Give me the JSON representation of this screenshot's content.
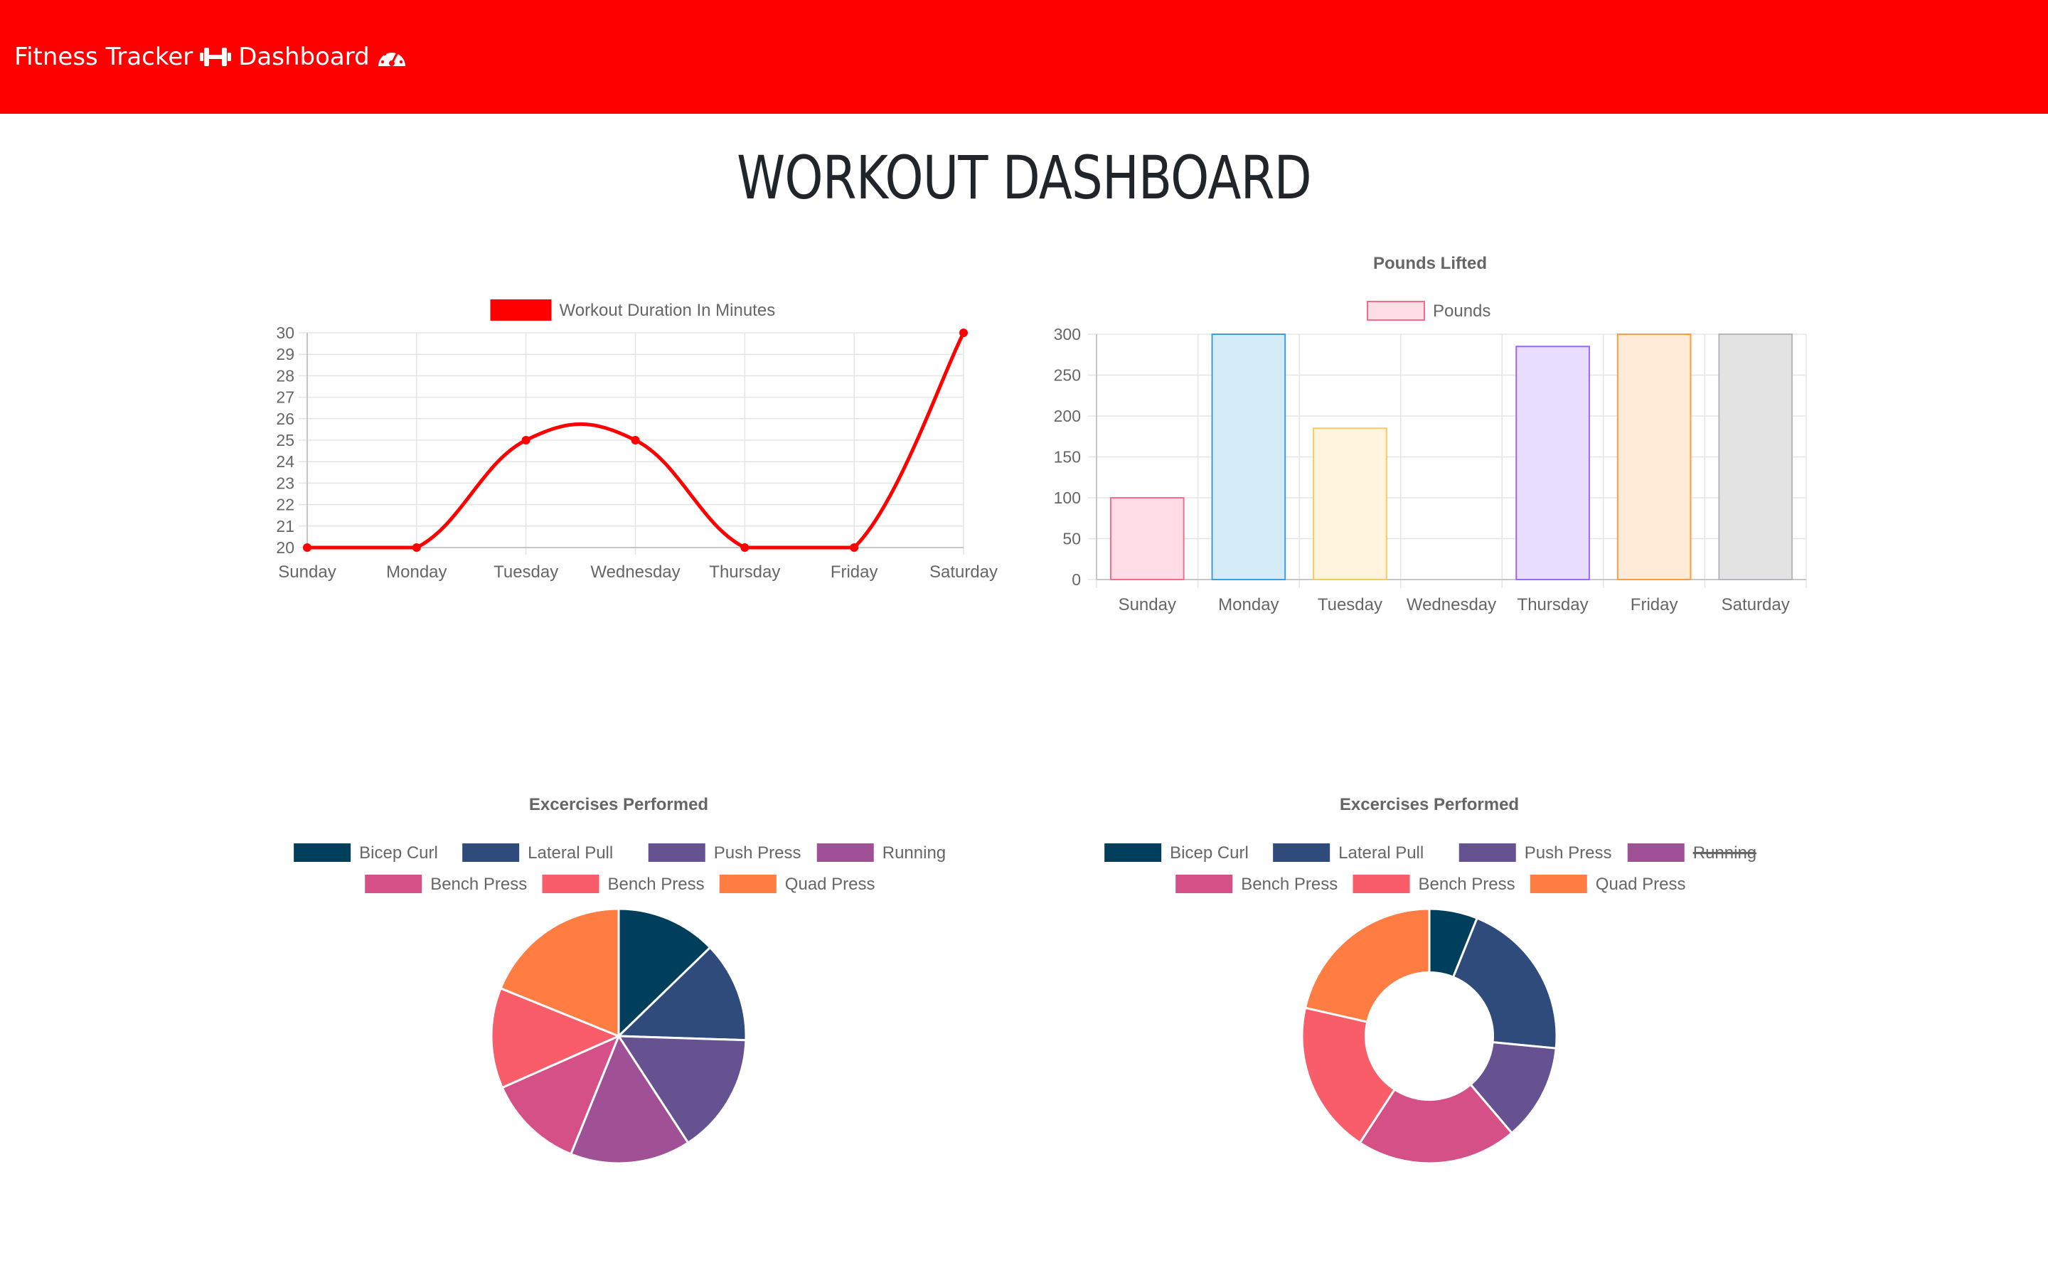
{
  "navbar": {
    "brand_text": "Fitness Tracker",
    "brand_icon": "dumbbell-icon",
    "dashboard_text": "Dashboard",
    "dashboard_icon": "tachometer-icon",
    "background": "#ff0000"
  },
  "page_title": "WORKOUT DASHBOARD",
  "chart_data": [
    {
      "type": "line",
      "title": "",
      "categories": [
        "Sunday",
        "Monday",
        "Tuesday",
        "Wednesday",
        "Thursday",
        "Friday",
        "Saturday"
      ],
      "series": [
        {
          "name": "Workout Duration In Minutes",
          "values": [
            20,
            20,
            25,
            25,
            20,
            20,
            30
          ],
          "color": "#ff0000"
        }
      ],
      "ylim": [
        20,
        30
      ],
      "yticks": [
        20,
        21,
        22,
        23,
        24,
        25,
        26,
        27,
        28,
        29,
        30
      ],
      "grid": true,
      "legend": "top"
    },
    {
      "type": "bar",
      "title": "Pounds Lifted",
      "categories": [
        "Sunday",
        "Monday",
        "Tuesday",
        "Wednesday",
        "Thursday",
        "Friday",
        "Saturday"
      ],
      "series": [
        {
          "name": "Pounds",
          "values": [
            100,
            300,
            185,
            0,
            285,
            300,
            300
          ],
          "fill_colors": [
            "#ffdde5",
            "#d6ebf8",
            "#fff4dd",
            "#e2f3f3",
            "#e9deff",
            "#ffebd7",
            "#e3e3e4"
          ],
          "border_colors": [
            "#f56d8a",
            "#37a0e4",
            "#f8cb5c",
            "#4bc0c0",
            "#9966ff",
            "#fb9e3f",
            "#b5b7bb"
          ]
        }
      ],
      "ylim": [
        0,
        300
      ],
      "yticks": [
        0,
        50,
        100,
        150,
        200,
        250,
        300
      ],
      "grid": true,
      "legend": "top"
    },
    {
      "type": "pie",
      "title": "Excercises Performed",
      "labels": [
        "Bicep Curl",
        "Lateral Pull",
        "Push Press",
        "Running",
        "Bench Press",
        "Bench Press",
        "Quad Press"
      ],
      "values": [
        12.5,
        12.5,
        15,
        15,
        12,
        12.5,
        18.5
      ],
      "colors": [
        "#003f5c",
        "#2f4b7c",
        "#665191",
        "#a05195",
        "#d45087",
        "#f95d6a",
        "#ff7c43"
      ],
      "hidden": [],
      "legend": "top"
    },
    {
      "type": "doughnut",
      "title": "Excercises Performed",
      "labels": [
        "Bicep Curl",
        "Lateral Pull",
        "Push Press",
        "Running",
        "Bench Press",
        "Bench Press",
        "Quad Press"
      ],
      "values": [
        6,
        20,
        12,
        0,
        20,
        19,
        21
      ],
      "colors": [
        "#003f5c",
        "#2f4b7c",
        "#665191",
        "#a05195",
        "#d45087",
        "#f95d6a",
        "#ff7c43"
      ],
      "hidden": [
        "Running"
      ],
      "legend": "top"
    }
  ]
}
